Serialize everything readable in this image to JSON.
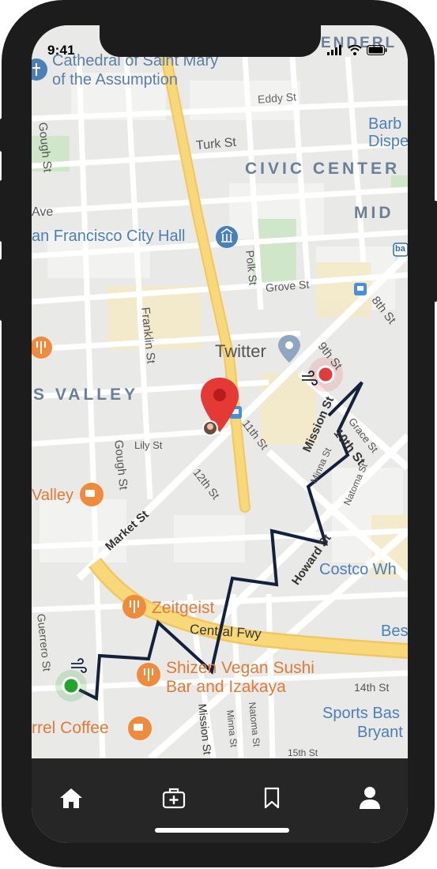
{
  "status_bar": {
    "time": "9:41"
  },
  "map": {
    "labels": {
      "cathedral_line1": "Cathedral of Saint Mary",
      "cathedral_line2": "of the Assumption",
      "eddy_st": "Eddy St",
      "turk_st": "Turk St",
      "gough_st_top": "Gough St",
      "civic_center": "CIVIC CENTER",
      "mid": "MID",
      "barb_line1": "Barb",
      "barb_line2": "Dispe",
      "ave": "Ave",
      "city_hall": "an Francisco City Hall",
      "polk_st": "Polk St",
      "grove_st": "Grove St",
      "eighth_st": "8th St",
      "franklin_st": "Franklin St",
      "twitter": "Twitter",
      "ninth_st": "9th St",
      "valley": "S VALLEY",
      "eleventh_st": "11th St",
      "lily_st": "Lily St",
      "gough_st_mid": "Gough St",
      "grace_st": "Grace St",
      "tenth_st": "10th St",
      "mission_st_mid": "Mission St",
      "minna_st_mid": "Minna St",
      "natoma_st_mid": "Natoma St",
      "twelfth_st": "12th St",
      "valley_cafe": "Valley",
      "market_st": "Market St",
      "howard_st": "Howard St",
      "costco": "Costco Wh",
      "zeitgeist": "Zeitgeist",
      "central_fwy": "Central Fwy",
      "best": "Bes",
      "guerrero_st": "Guerrero St",
      "shizen_line1": "Shizen Vegan Sushi",
      "shizen_line2": "Bar and Izakaya",
      "fourteenth_st": "14th St",
      "sports_line1": "Sports Bas",
      "sports_line2": "Bryant",
      "coffee": "rrel Coffee",
      "mission_st_bottom": "Mission St",
      "minna_st_bottom": "Minna St",
      "natoma_st_bottom": "Natoma St",
      "fifteenth_st": "15th St",
      "top_right_fragment": "ENDERL",
      "bart": "ba"
    },
    "colors": {
      "route": "#14213d",
      "start_marker": "#22a52f",
      "end_marker": "#e23b3b",
      "destination_pin": "#e53935",
      "highway": "#f8d878",
      "poi_orange": "#f08a3c",
      "poi_blue": "#4a7fb8"
    }
  },
  "tab_bar": {
    "items": [
      {
        "name": "home",
        "icon": "home-icon"
      },
      {
        "name": "medical",
        "icon": "medical-kit-icon"
      },
      {
        "name": "saved",
        "icon": "bookmark-icon"
      },
      {
        "name": "profile",
        "icon": "user-icon"
      }
    ]
  }
}
